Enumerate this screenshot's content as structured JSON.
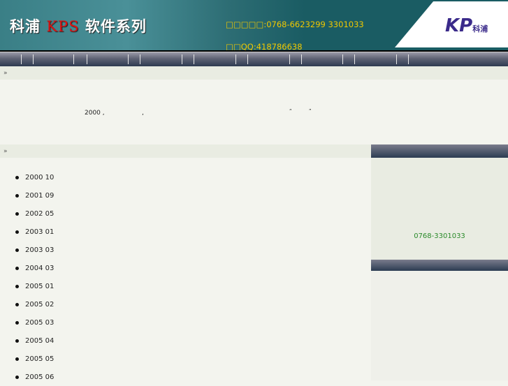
{
  "header": {
    "logo_prefix": "科浦 ",
    "logo_kps": "KPS",
    "logo_suffix": " 软件系列",
    "contact_lines": [
      "",
      "",
      "□□□□□:0768-6623299   3301033",
      "",
      "□□QQ:418786638"
    ],
    "brand": "KP",
    "brand_sub": "科浦"
  },
  "sections": {
    "bar1_label": "»",
    "bar2_label": "»"
  },
  "intro": {
    "year": "2000 ,",
    "comma": ",",
    "quote_open": "“",
    "quote_close": "”"
  },
  "sidebar": {
    "phone": "0768-3301033"
  },
  "history": [
    "2000 10",
    "2001 09",
    "2002 05",
    "2003 01",
    "2003 03",
    "2004 03",
    "2005 01",
    "2005 02",
    "2005 03",
    "2005 04",
    "2005 05",
    "2005 06"
  ]
}
